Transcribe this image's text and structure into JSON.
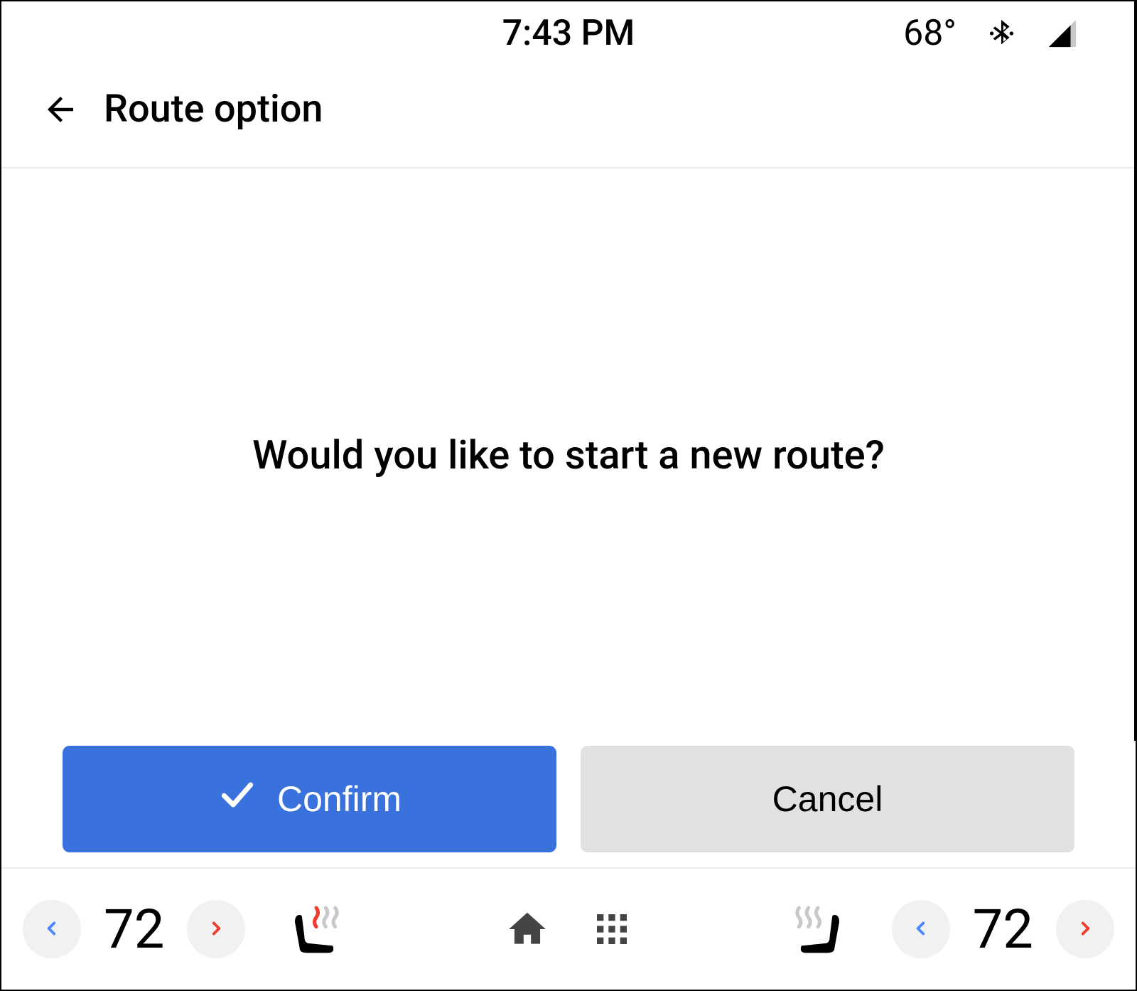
{
  "status": {
    "time": "7:43 PM",
    "outside_temp": "68°"
  },
  "header": {
    "title": "Route option"
  },
  "main": {
    "prompt": "Would you like to start a new route?",
    "confirm_label": "Confirm",
    "cancel_label": "Cancel"
  },
  "climate": {
    "left_temp": "72",
    "right_temp": "72"
  },
  "colors": {
    "primary": "#3a72dd",
    "chevron_cool": "#4a86ff",
    "chevron_warm": "#f03b2d"
  }
}
